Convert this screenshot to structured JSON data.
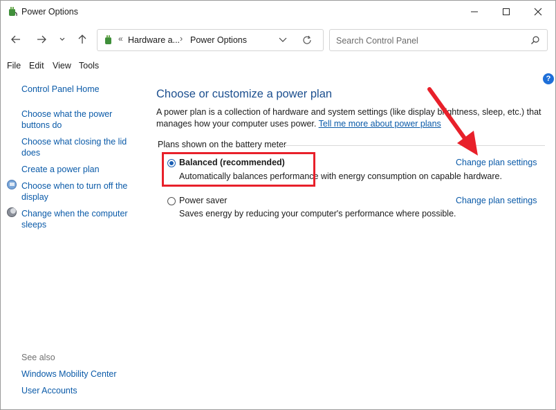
{
  "window": {
    "title": "Power Options"
  },
  "address": {
    "crumbs": [
      "Hardware a...",
      "Power Options"
    ],
    "overflow": "«",
    "separator": "›"
  },
  "search": {
    "placeholder": "Search Control Panel"
  },
  "menu": [
    "File",
    "Edit",
    "View",
    "Tools"
  ],
  "left_pane": {
    "home": "Control Panel Home",
    "links": [
      "Choose what the power buttons do",
      "Choose what closing the lid does",
      "Create a power plan",
      "Choose when to turn off the display",
      "Change when the computer sleeps"
    ],
    "see_also_label": "See also",
    "see_also": [
      "Windows Mobility Center",
      "User Accounts"
    ]
  },
  "main": {
    "heading": "Choose or customize a power plan",
    "description": "A power plan is a collection of hardware and system settings (like display brightness, sleep, etc.) that manages how your computer uses power.",
    "learn_more": "Tell me more about power plans",
    "group_label": "Plans shown on the battery meter",
    "plans": [
      {
        "name": "Balanced (recommended)",
        "description": "Automatically balances performance with energy consumption on capable hardware.",
        "link": "Change plan settings",
        "selected": true
      },
      {
        "name": "Power saver",
        "description": "Saves energy by reducing your computer's performance where possible.",
        "link": "Change plan settings",
        "selected": false
      }
    ]
  },
  "help": "?",
  "colors": {
    "annotation_red": "#e8202a",
    "link_blue": "#0a5aa8",
    "heading_blue": "#1c4f8f"
  }
}
